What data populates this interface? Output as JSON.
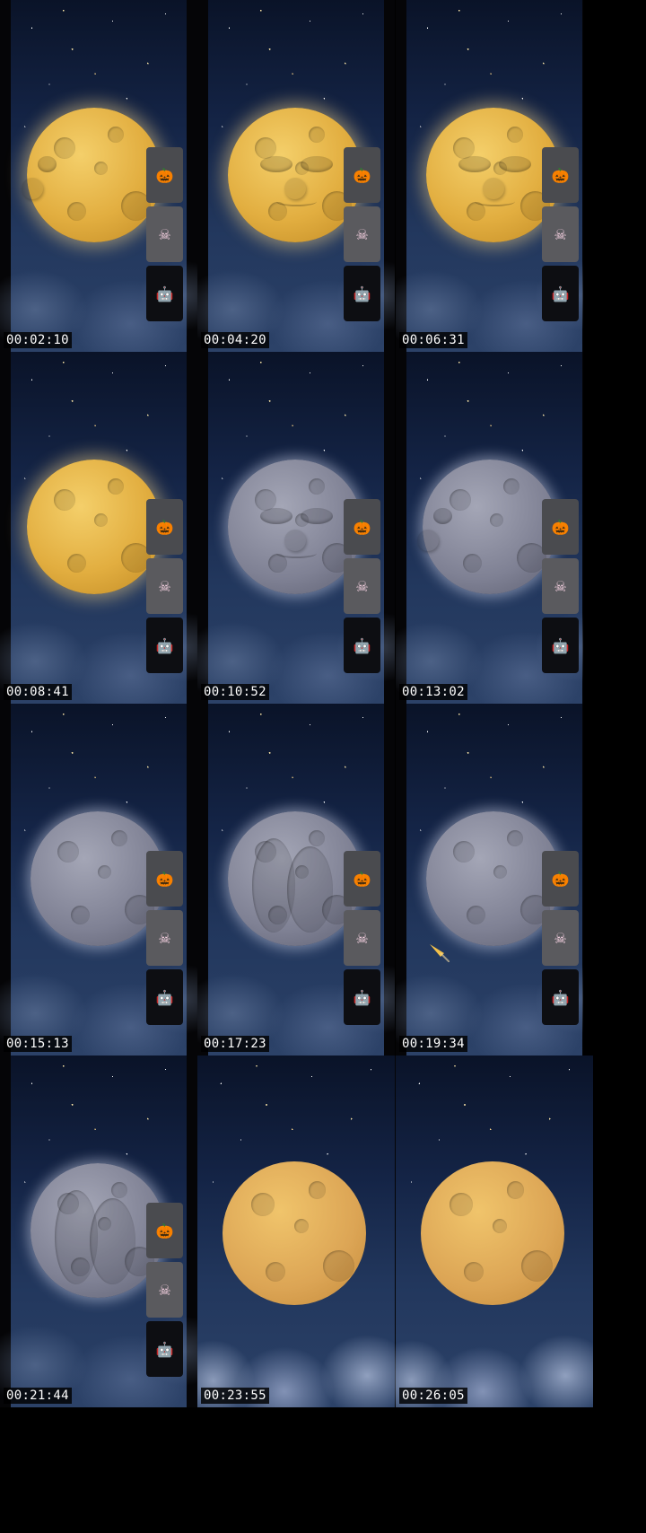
{
  "frames": [
    {
      "timestamp": "00:02:10",
      "moon": "gold",
      "face": "side",
      "panel": true
    },
    {
      "timestamp": "00:04:20",
      "moon": "gold",
      "face": "front",
      "panel": true
    },
    {
      "timestamp": "00:06:31",
      "moon": "gold",
      "face": "front",
      "panel": true
    },
    {
      "timestamp": "00:08:41",
      "moon": "gold",
      "face": "side-away",
      "panel": true
    },
    {
      "timestamp": "00:10:52",
      "moon": "grey",
      "face": "front",
      "panel": true
    },
    {
      "timestamp": "00:13:02",
      "moon": "grey",
      "face": "side",
      "panel": true
    },
    {
      "timestamp": "00:15:13",
      "moon": "grey",
      "face": "craters",
      "panel": true
    },
    {
      "timestamp": "00:17:23",
      "moon": "grey",
      "face": "bottom",
      "panel": true
    },
    {
      "timestamp": "00:19:34",
      "moon": "grey",
      "face": "craters",
      "panel": true,
      "rocket": true
    },
    {
      "timestamp": "00:21:44",
      "moon": "grey",
      "face": "bottom",
      "panel": true
    },
    {
      "timestamp": "00:23:55",
      "moon": "gold-flat",
      "face": "craters",
      "panel": false
    },
    {
      "timestamp": "00:26:05",
      "moon": "gold-flat",
      "face": "craters",
      "panel": false
    }
  ],
  "panel_icons": [
    "pumpkin-icon",
    "skull-badge-icon",
    "robot-icon"
  ],
  "colors": {
    "sky_top": "#0a1328",
    "sky_bottom": "#2c4268",
    "moon_gold": "#e2ae40",
    "moon_grey": "#7f8194"
  }
}
